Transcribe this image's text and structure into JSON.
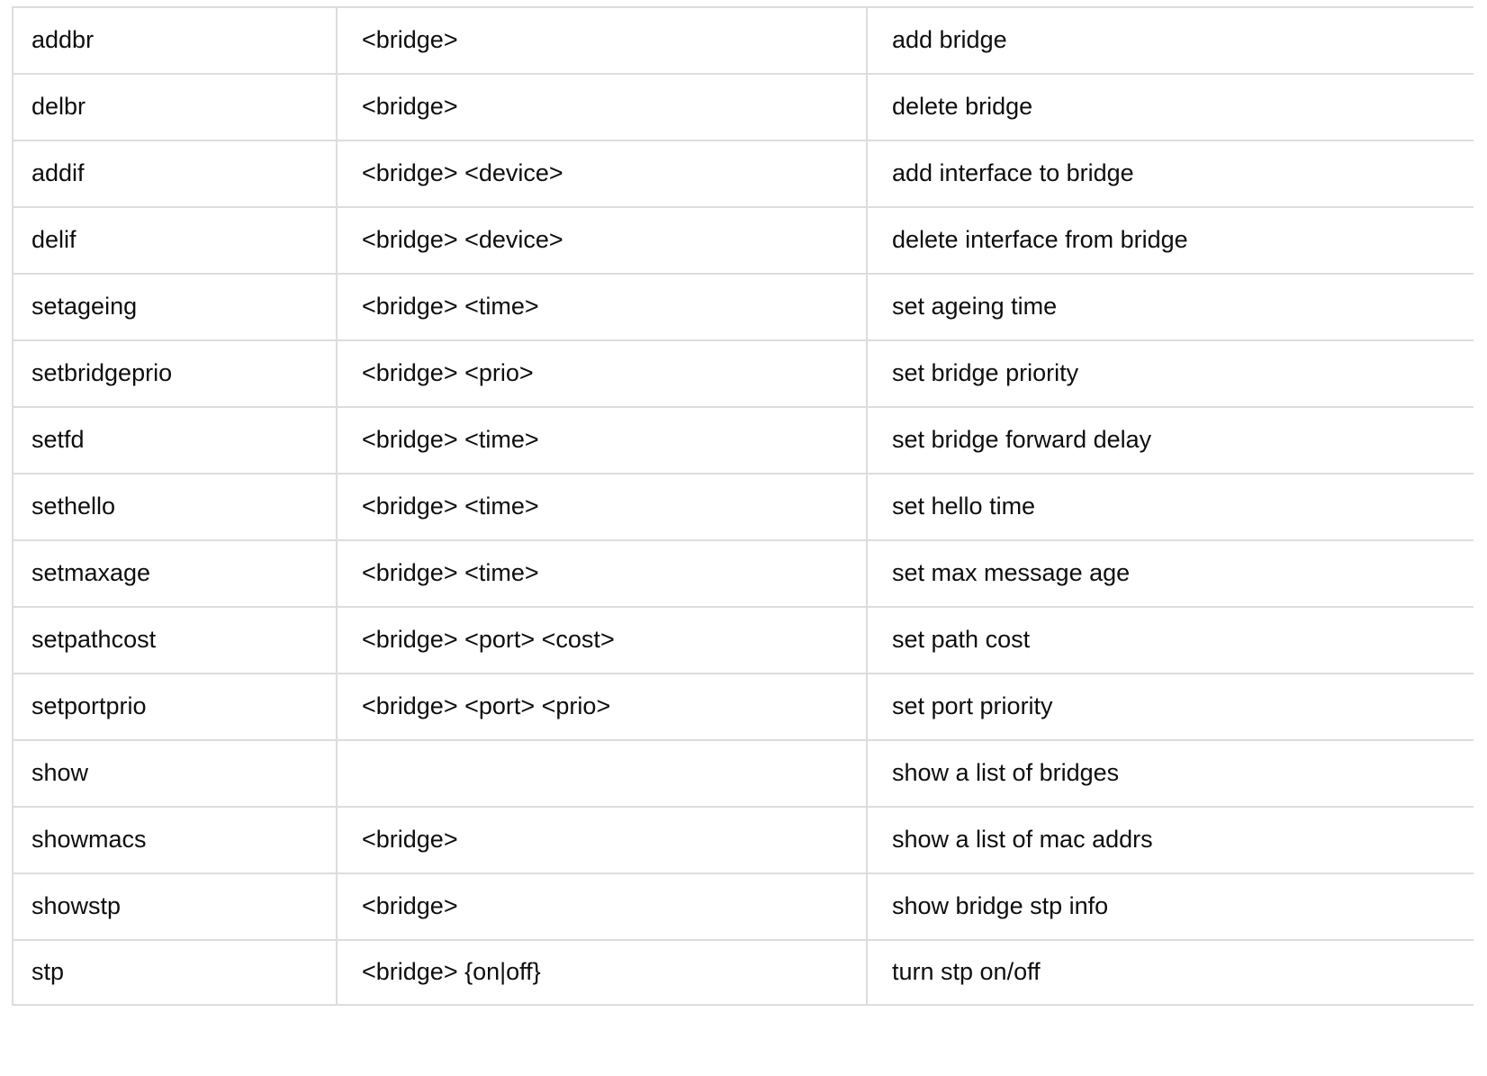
{
  "table": {
    "columns": [
      {
        "key": "command",
        "name": "command-column"
      },
      {
        "key": "args",
        "name": "arguments-column"
      },
      {
        "key": "description",
        "name": "description-column"
      }
    ],
    "rows": [
      {
        "command": "addbr",
        "args": "<bridge>",
        "description": "add bridge"
      },
      {
        "command": "delbr",
        "args": "<bridge>",
        "description": "delete bridge"
      },
      {
        "command": "addif",
        "args": "<bridge> <device>",
        "description": "add interface to bridge"
      },
      {
        "command": "delif",
        "args": "<bridge> <device>",
        "description": "delete interface from bridge"
      },
      {
        "command": "setageing",
        "args": "<bridge> <time>",
        "description": "set ageing time"
      },
      {
        "command": "setbridgeprio",
        "args": "<bridge> <prio>",
        "description": "set bridge priority"
      },
      {
        "command": "setfd",
        "args": "<bridge> <time>",
        "description": "set bridge forward delay"
      },
      {
        "command": "sethello",
        "args": "<bridge> <time>",
        "description": "set hello time"
      },
      {
        "command": "setmaxage",
        "args": "<bridge> <time>",
        "description": "set max message age"
      },
      {
        "command": "setpathcost",
        "args": "<bridge> <port> <cost>",
        "description": "set path cost"
      },
      {
        "command": "setportprio",
        "args": "<bridge> <port> <prio>",
        "description": "set port priority"
      },
      {
        "command": "show",
        "args": "",
        "description": "show a list of bridges"
      },
      {
        "command": "showmacs",
        "args": "<bridge>",
        "description": "show a list of mac addrs"
      },
      {
        "command": "showstp",
        "args": "<bridge>",
        "description": "show bridge stp info"
      },
      {
        "command": "stp",
        "args": "<bridge> {on|off}",
        "description": "turn stp on/off"
      }
    ]
  },
  "colors": {
    "border": "#dddddd",
    "text": "#0e0e0e",
    "background": "#ffffff"
  }
}
